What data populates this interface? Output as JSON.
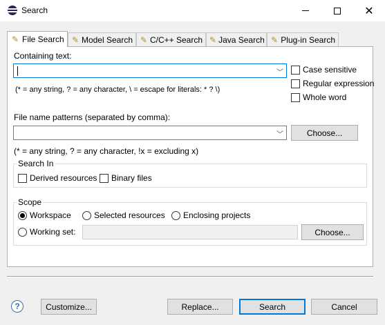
{
  "window": {
    "title": "Search",
    "minimize": "—",
    "maximize": "☐",
    "close": "✕"
  },
  "tabs": [
    {
      "label": "File Search",
      "icon": "file-search-icon"
    },
    {
      "label": "Model Search",
      "icon": "model-search-icon"
    },
    {
      "label": "C/C++ Search",
      "icon": "cpp-search-icon"
    },
    {
      "label": "Java Search",
      "icon": "java-search-icon"
    },
    {
      "label": "Plug-in Search",
      "icon": "plugin-search-icon"
    }
  ],
  "containing": {
    "label": "Containing text:",
    "value": "",
    "hint": "(* = any string, ? = any character, \\ = escape for literals: * ? \\)"
  },
  "options": {
    "case_sensitive": "Case sensitive",
    "regular_expression": "Regular expression",
    "whole_word": "Whole word"
  },
  "patterns": {
    "label": "File name patterns (separated by comma):",
    "value": "",
    "hint": "(* = any string, ? = any character, !x = excluding x)",
    "choose": "Choose..."
  },
  "search_in": {
    "title": "Search In",
    "derived": "Derived resources",
    "binary": "Binary files"
  },
  "scope": {
    "title": "Scope",
    "workspace": "Workspace",
    "selected_resources": "Selected resources",
    "enclosing_projects": "Enclosing projects",
    "working_set": "Working set:",
    "working_set_value": "",
    "choose": "Choose..."
  },
  "footer": {
    "help": "?",
    "customize": "Customize...",
    "replace": "Replace...",
    "search": "Search",
    "cancel": "Cancel"
  },
  "colors": {
    "accent": "#0078d7",
    "dialog_bg": "#f0f0f0"
  }
}
